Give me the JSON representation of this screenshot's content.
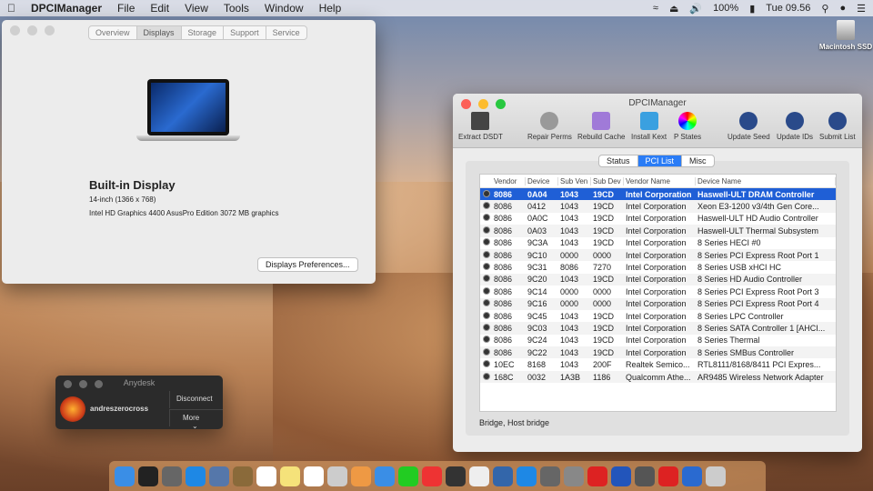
{
  "menubar": {
    "app": "DPCIManager",
    "items": [
      "File",
      "Edit",
      "View",
      "Tools",
      "Window",
      "Help"
    ],
    "battery": "100%",
    "clock": "Tue 09.56"
  },
  "desktop": {
    "icons": [
      "Macintosh SSD"
    ]
  },
  "displays_window": {
    "tabs": [
      "Overview",
      "Displays",
      "Storage",
      "Support",
      "Service"
    ],
    "active_tab": "Displays",
    "display_name": "Built-in Display",
    "size": "14-inch (1366 x 768)",
    "graphics": "Intel HD Graphics 4400 AsusPro Edition 3072 MB graphics",
    "prefs_button": "Displays Preferences..."
  },
  "dpci": {
    "title": "DPCIManager",
    "toolbar": [
      "Extract DSDT",
      "Repair Perms",
      "Rebuild Cache",
      "Install Kext",
      "P States",
      "Update Seed",
      "Update IDs",
      "Submit List"
    ],
    "tabs": [
      "Status",
      "PCI List",
      "Misc"
    ],
    "active_tab": "PCI List",
    "columns": [
      "Vendor",
      "Device",
      "Sub Ven",
      "Sub Dev",
      "Vendor Name",
      "Device Name"
    ],
    "rows": [
      [
        "8086",
        "0A04",
        "1043",
        "19CD",
        "Intel Corporation",
        "Haswell-ULT DRAM Controller"
      ],
      [
        "8086",
        "0412",
        "1043",
        "19CD",
        "Intel Corporation",
        "Xeon E3-1200 v3/4th Gen Core..."
      ],
      [
        "8086",
        "0A0C",
        "1043",
        "19CD",
        "Intel Corporation",
        "Haswell-ULT HD Audio Controller"
      ],
      [
        "8086",
        "0A03",
        "1043",
        "19CD",
        "Intel Corporation",
        "Haswell-ULT Thermal Subsystem"
      ],
      [
        "8086",
        "9C3A",
        "1043",
        "19CD",
        "Intel Corporation",
        "8 Series HECI #0"
      ],
      [
        "8086",
        "9C10",
        "0000",
        "0000",
        "Intel Corporation",
        "8 Series PCI Express Root Port 1"
      ],
      [
        "8086",
        "9C31",
        "8086",
        "7270",
        "Intel Corporation",
        "8 Series USB xHCI HC"
      ],
      [
        "8086",
        "9C20",
        "1043",
        "19CD",
        "Intel Corporation",
        "8 Series HD Audio Controller"
      ],
      [
        "8086",
        "9C14",
        "0000",
        "0000",
        "Intel Corporation",
        "8 Series PCI Express Root Port 3"
      ],
      [
        "8086",
        "9C16",
        "0000",
        "0000",
        "Intel Corporation",
        "8 Series PCI Express Root Port 4"
      ],
      [
        "8086",
        "9C45",
        "1043",
        "19CD",
        "Intel Corporation",
        "8 Series LPC Controller"
      ],
      [
        "8086",
        "9C03",
        "1043",
        "19CD",
        "Intel Corporation",
        "8 Series SATA Controller 1 [AHCI..."
      ],
      [
        "8086",
        "9C24",
        "1043",
        "19CD",
        "Intel Corporation",
        "8 Series Thermal"
      ],
      [
        "8086",
        "9C22",
        "1043",
        "19CD",
        "Intel Corporation",
        "8 Series SMBus Controller"
      ],
      [
        "10EC",
        "8168",
        "1043",
        "200F",
        "Realtek Semico...",
        "RTL8111/8168/8411 PCI Expres..."
      ],
      [
        "168C",
        "0032",
        "1A3B",
        "1186",
        "Qualcomm Athe...",
        "AR9485 Wireless Network Adapter"
      ]
    ],
    "status": "Bridge, Host bridge"
  },
  "anydesk": {
    "title": "Anydesk",
    "user": "andreszerocross",
    "disconnect": "Disconnect",
    "more": "More"
  },
  "dock_colors": [
    "#3a8ee6",
    "#222",
    "#666",
    "#1e88e5",
    "#5577aa",
    "#8a6a3a",
    "#fff",
    "#f5e27a",
    "#fff",
    "#ccc",
    "#e94",
    "#3a8ee6",
    "#2c2",
    "#e33",
    "#333",
    "#eee",
    "#3366aa",
    "#1e88e5",
    "#666",
    "#888",
    "#d22",
    "#2255bb",
    "#555",
    "#d22",
    "#2a6ad0",
    "#ccc"
  ]
}
